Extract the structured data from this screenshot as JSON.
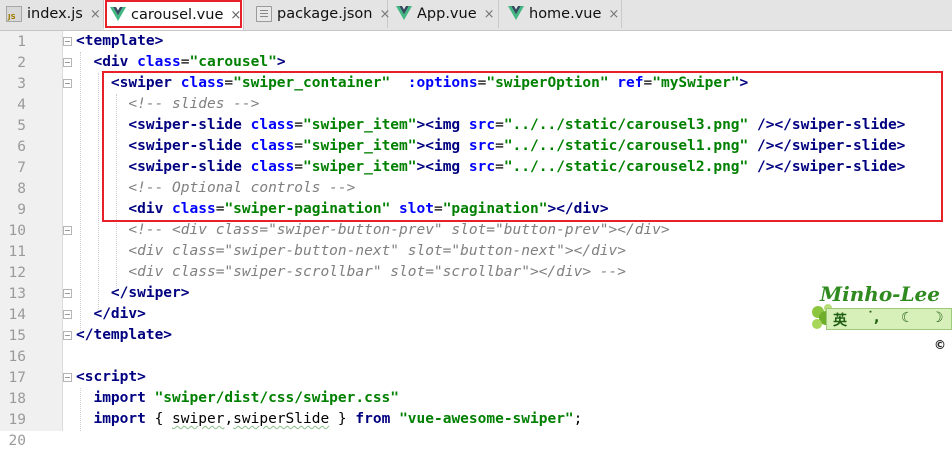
{
  "tabs": [
    {
      "label": "index.js",
      "icon": "js-file-icon",
      "active": false
    },
    {
      "label": "carousel.vue",
      "icon": "vue-file-icon",
      "active": true
    },
    {
      "label": "package.json",
      "icon": "json-file-icon",
      "active": false
    },
    {
      "label": "App.vue",
      "icon": "vue-file-icon",
      "active": false
    },
    {
      "label": "home.vue",
      "icon": "vue-file-icon",
      "active": false
    }
  ],
  "close_glyph": "×",
  "js_badge": "JS",
  "line_numbers": [
    "1",
    "2",
    "3",
    "4",
    "5",
    "6",
    "7",
    "8",
    "9",
    "10",
    "11",
    "12",
    "13",
    "14",
    "15",
    "16",
    "17",
    "18",
    "19",
    "20"
  ],
  "code": {
    "l1": {
      "open": "<template>"
    },
    "l2": {
      "tag": "<div ",
      "attr": "class",
      "eq": "=",
      "val": "\"carousel\"",
      "close": ">"
    },
    "l3": {
      "tag": "<swiper ",
      "attr1": "class",
      "eq1": "=",
      "val1": "\"swiper_container\"",
      "sp1": "  ",
      "attr2": ":options",
      "eq2": "=",
      "val2": "\"swiperOption\"",
      "sp2": " ",
      "attr3": "ref",
      "eq3": "=",
      "val3": "\"mySwiper\"",
      "close": ">"
    },
    "l4": "<!-- slides -->",
    "l5": {
      "tag": "<swiper-slide ",
      "attr": "class",
      "eq": "=",
      "val": "\"swiper_item\"",
      "mid": "><img ",
      "attr2": "src",
      "eq2": "=",
      "val2": "\"../../static/carousel3.png\"",
      "end": " /></swiper-slide>"
    },
    "l6": {
      "tag": "<swiper-slide ",
      "attr": "class",
      "eq": "=",
      "val": "\"swiper_item\"",
      "mid": "><img ",
      "attr2": "src",
      "eq2": "=",
      "val2": "\"../../static/carousel1.png\"",
      "end": " /></swiper-slide>"
    },
    "l7": {
      "tag": "<swiper-slide ",
      "attr": "class",
      "eq": "=",
      "val": "\"swiper_item\"",
      "mid": "><img ",
      "attr2": "src",
      "eq2": "=",
      "val2": "\"../../static/carousel2.png\"",
      "end": " /></swiper-slide>"
    },
    "l8": "<!-- Optional controls -->",
    "l9": {
      "tag": "<div ",
      "attr": "class",
      "eq": "=",
      "val": "\"swiper-pagination\"",
      "sp": " ",
      "attr2": "slot",
      "eq2": "=",
      "val2": "\"pagination\"",
      "end": "></div>"
    },
    "l10": "<!-- <div class=\"swiper-button-prev\" slot=\"button-prev\"></div>",
    "l11": "<div class=\"swiper-button-next\" slot=\"button-next\"></div>",
    "l12": "<div class=\"swiper-scrollbar\" slot=\"scrollbar\"></div> -->",
    "l13": "</swiper>",
    "l14": "</div>",
    "l15": "</template>",
    "l17": "<script>",
    "l18": {
      "kw": "import ",
      "str": "\"swiper/dist/css/swiper.css\""
    },
    "l19": {
      "kw": "import ",
      "brace": "{ ",
      "id1": "swiper",
      "comma": ",",
      "id2": "swiperSlide",
      "rest": " } ",
      "kw2": "from ",
      "str": "\"vue-awesome-swiper\"",
      "semi": ";"
    }
  },
  "watermark": {
    "name": "Minho-Lee",
    "chars": [
      "英",
      "˙,",
      "☾",
      "☽"
    ],
    "copy": "©"
  },
  "colors": {
    "tag": "#000080",
    "attr": "#0000ff",
    "string": "#008000",
    "comment": "#808080",
    "highlight": "#e8202a"
  }
}
